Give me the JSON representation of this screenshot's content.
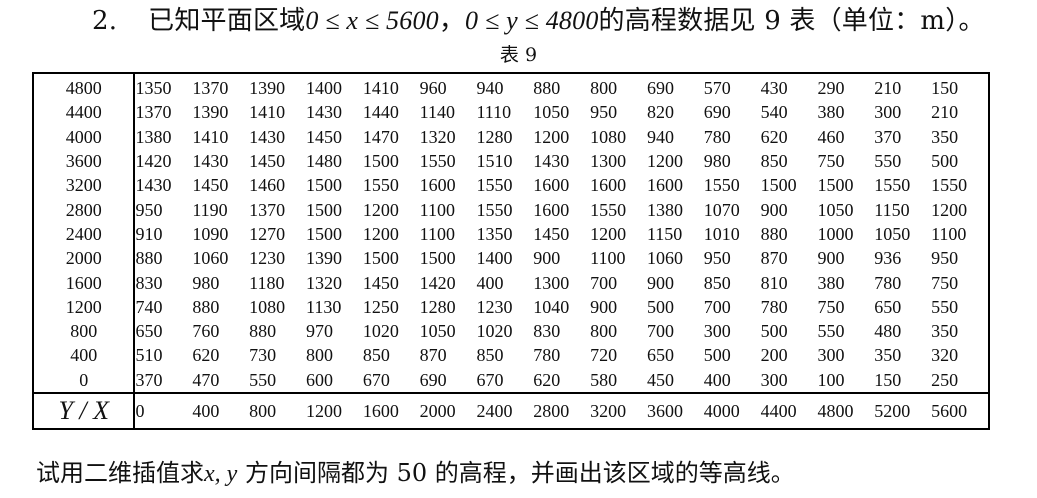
{
  "problem": {
    "number": "2.",
    "text_before": "已知平面区域",
    "range_x": "0 ≤ x ≤ 5600",
    "comma1": "，",
    "range_y": "0 ≤ y ≤ 4800",
    "text_after": "的高程数据见 9 表（单位：m）。"
  },
  "table": {
    "title": "表 9",
    "corner_label": "Y / X",
    "x_values": [
      "0",
      "400",
      "800",
      "1200",
      "1600",
      "2000",
      "2400",
      "2800",
      "3200",
      "3600",
      "4000",
      "4400",
      "4800",
      "5200",
      "5600"
    ],
    "rows": [
      {
        "y": "4800",
        "values": [
          "1350",
          "1370",
          "1390",
          "1400",
          "1410",
          "960",
          "940",
          "880",
          "800",
          "690",
          "570",
          "430",
          "290",
          "210",
          "150"
        ]
      },
      {
        "y": "4400",
        "values": [
          "1370",
          "1390",
          "1410",
          "1430",
          "1440",
          "1140",
          "1110",
          "1050",
          "950",
          "820",
          "690",
          "540",
          "380",
          "300",
          "210"
        ]
      },
      {
        "y": "4000",
        "values": [
          "1380",
          "1410",
          "1430",
          "1450",
          "1470",
          "1320",
          "1280",
          "1200",
          "1080",
          "940",
          "780",
          "620",
          "460",
          "370",
          "350"
        ]
      },
      {
        "y": "3600",
        "values": [
          "1420",
          "1430",
          "1450",
          "1480",
          "1500",
          "1550",
          "1510",
          "1430",
          "1300",
          "1200",
          "980",
          "850",
          "750",
          "550",
          "500"
        ]
      },
      {
        "y": "3200",
        "values": [
          "1430",
          "1450",
          "1460",
          "1500",
          "1550",
          "1600",
          "1550",
          "1600",
          "1600",
          "1600",
          "1550",
          "1500",
          "1500",
          "1550",
          "1550"
        ]
      },
      {
        "y": "2800",
        "values": [
          "950",
          "1190",
          "1370",
          "1500",
          "1200",
          "1100",
          "1550",
          "1600",
          "1550",
          "1380",
          "1070",
          "900",
          "1050",
          "1150",
          "1200"
        ]
      },
      {
        "y": "2400",
        "values": [
          "910",
          "1090",
          "1270",
          "1500",
          "1200",
          "1100",
          "1350",
          "1450",
          "1200",
          "1150",
          "1010",
          "880",
          "1000",
          "1050",
          "1100"
        ]
      },
      {
        "y": "2000",
        "values": [
          "880",
          "1060",
          "1230",
          "1390",
          "1500",
          "1500",
          "1400",
          "900",
          "1100",
          "1060",
          "950",
          "870",
          "900",
          "936",
          "950"
        ]
      },
      {
        "y": "1600",
        "values": [
          "830",
          "980",
          "1180",
          "1320",
          "1450",
          "1420",
          "400",
          "1300",
          "700",
          "900",
          "850",
          "810",
          "380",
          "780",
          "750"
        ]
      },
      {
        "y": "1200",
        "values": [
          "740",
          "880",
          "1080",
          "1130",
          "1250",
          "1280",
          "1230",
          "1040",
          "900",
          "500",
          "700",
          "780",
          "750",
          "650",
          "550"
        ]
      },
      {
        "y": "800",
        "values": [
          "650",
          "760",
          "880",
          "970",
          "1020",
          "1050",
          "1020",
          "830",
          "800",
          "700",
          "300",
          "500",
          "550",
          "480",
          "350"
        ]
      },
      {
        "y": "400",
        "values": [
          "510",
          "620",
          "730",
          "800",
          "850",
          "870",
          "850",
          "780",
          "720",
          "650",
          "500",
          "200",
          "300",
          "350",
          "320"
        ]
      },
      {
        "y": "0",
        "values": [
          "370",
          "470",
          "550",
          "600",
          "670",
          "690",
          "670",
          "620",
          "580",
          "450",
          "400",
          "300",
          "100",
          "150",
          "250"
        ]
      }
    ]
  },
  "footer": {
    "text_before": "试用二维插值求",
    "vars": "x, y",
    "text_after": "方向间隔都为 50 的高程，并画出该区域的等高线。"
  }
}
